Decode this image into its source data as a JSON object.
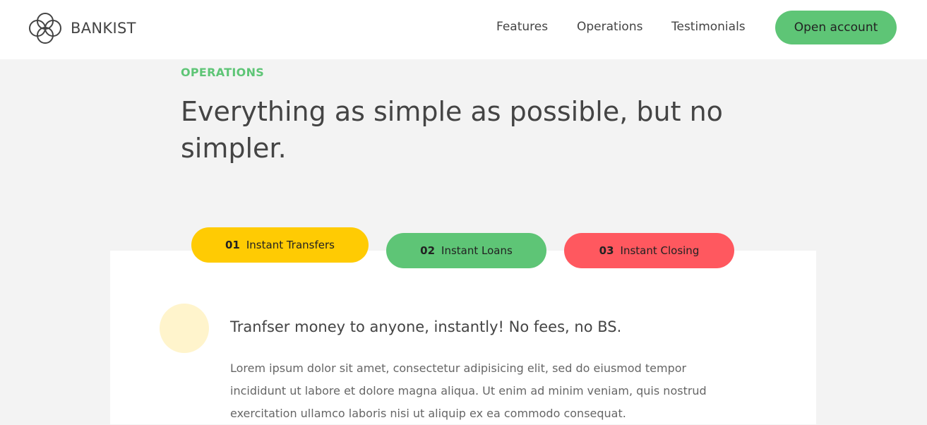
{
  "nav": {
    "brand": "BANKIST",
    "links": [
      "Features",
      "Operations",
      "Testimonials"
    ],
    "cta_label": "Open account"
  },
  "section": {
    "label": "OPERATIONS",
    "title": "Everything as simple as possible, but no simpler."
  },
  "tabs": [
    {
      "number": "01",
      "label": "Instant Transfers",
      "color": "#ffcb03",
      "active": true
    },
    {
      "number": "02",
      "label": "Instant Loans",
      "color": "#5ec576",
      "active": false
    },
    {
      "number": "03",
      "label": "Instant Closing",
      "color": "#ff585f",
      "active": false
    }
  ],
  "content": {
    "heading": "Tranfser money to anyone, instantly! No fees, no BS.",
    "text": "Lorem ipsum dolor sit amet, consectetur adipisicing elit, sed do eiusmod tempor incididunt ut labore et dolore magna aliqua. Ut enim ad minim veniam, quis nostrud exercitation ullamco laboris nisi ut aliquip ex ea commodo consequat."
  },
  "colors": {
    "primary": "#5ec576",
    "secondary": "#ffcb03",
    "tertiary": "#ff585f",
    "icon_bg": "#fff4cc"
  }
}
